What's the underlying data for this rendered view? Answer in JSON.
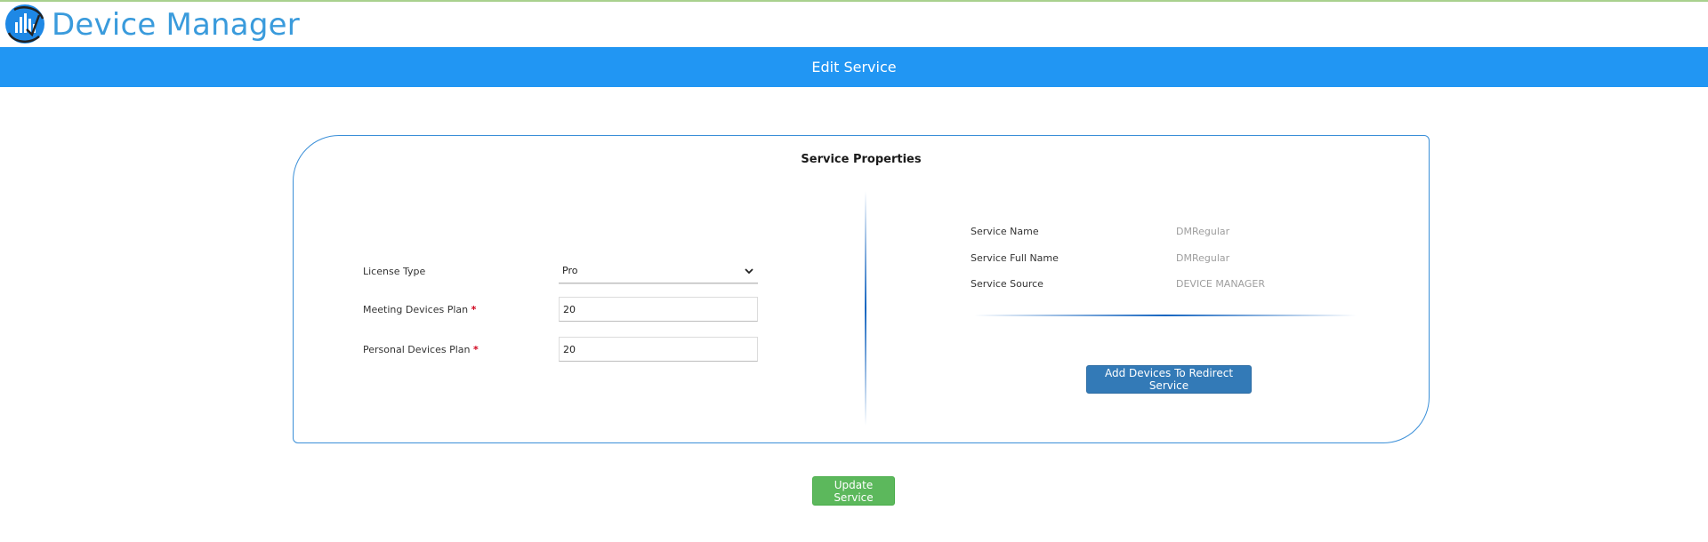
{
  "app": {
    "title": "Device Manager",
    "logo_icon": "signal-bars-logo-icon"
  },
  "banner": {
    "title": "Edit Service"
  },
  "panel": {
    "title": "Service Properties"
  },
  "form": {
    "license_type": {
      "label": "License Type",
      "value": "Pro"
    },
    "meeting_devices_plan": {
      "label": "Meeting Devices Plan",
      "required_mark": "*",
      "value": "20"
    },
    "personal_devices_plan": {
      "label": "Personal Devices Plan",
      "required_mark": "*",
      "value": "20"
    }
  },
  "info": {
    "service_name": {
      "label": "Service Name",
      "value": "DMRegular"
    },
    "service_full_name": {
      "label": "Service Full Name",
      "value": "DMRegular"
    },
    "service_source": {
      "label": "Service Source",
      "value": "DEVICE MANAGER"
    }
  },
  "buttons": {
    "add_devices_redirect": "Add Devices To Redirect Service",
    "update_service": "Update Service"
  },
  "colors": {
    "brand": "#3a9bdc",
    "banner": "#2196f3",
    "primary_button": "#337ab7",
    "success_button": "#5cb85c",
    "required": "#d0021b"
  }
}
